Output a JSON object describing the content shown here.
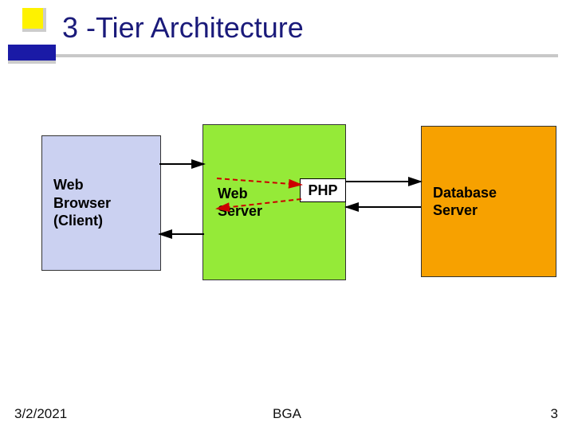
{
  "title": "3 -Tier Architecture",
  "tiers": {
    "client": "Web\nBrowser\n(Client)",
    "webserver": "Web\nServer",
    "php": "PHP",
    "db": "Database\nServer"
  },
  "footer": {
    "date": "3/2/2021",
    "center": "BGA",
    "page": "3"
  },
  "arrows": [
    {
      "from": "client",
      "to": "webserver",
      "style": "solid",
      "dir": "right"
    },
    {
      "from": "webserver",
      "to": "client",
      "style": "solid",
      "dir": "left"
    },
    {
      "from": "webserver",
      "to": "php",
      "style": "dashed",
      "dir": "right",
      "color": "red"
    },
    {
      "from": "php",
      "to": "webserver",
      "style": "dashed",
      "dir": "left",
      "color": "red"
    },
    {
      "from": "php",
      "to": "db",
      "style": "solid",
      "dir": "right"
    },
    {
      "from": "db",
      "to": "php",
      "style": "solid",
      "dir": "left"
    }
  ]
}
